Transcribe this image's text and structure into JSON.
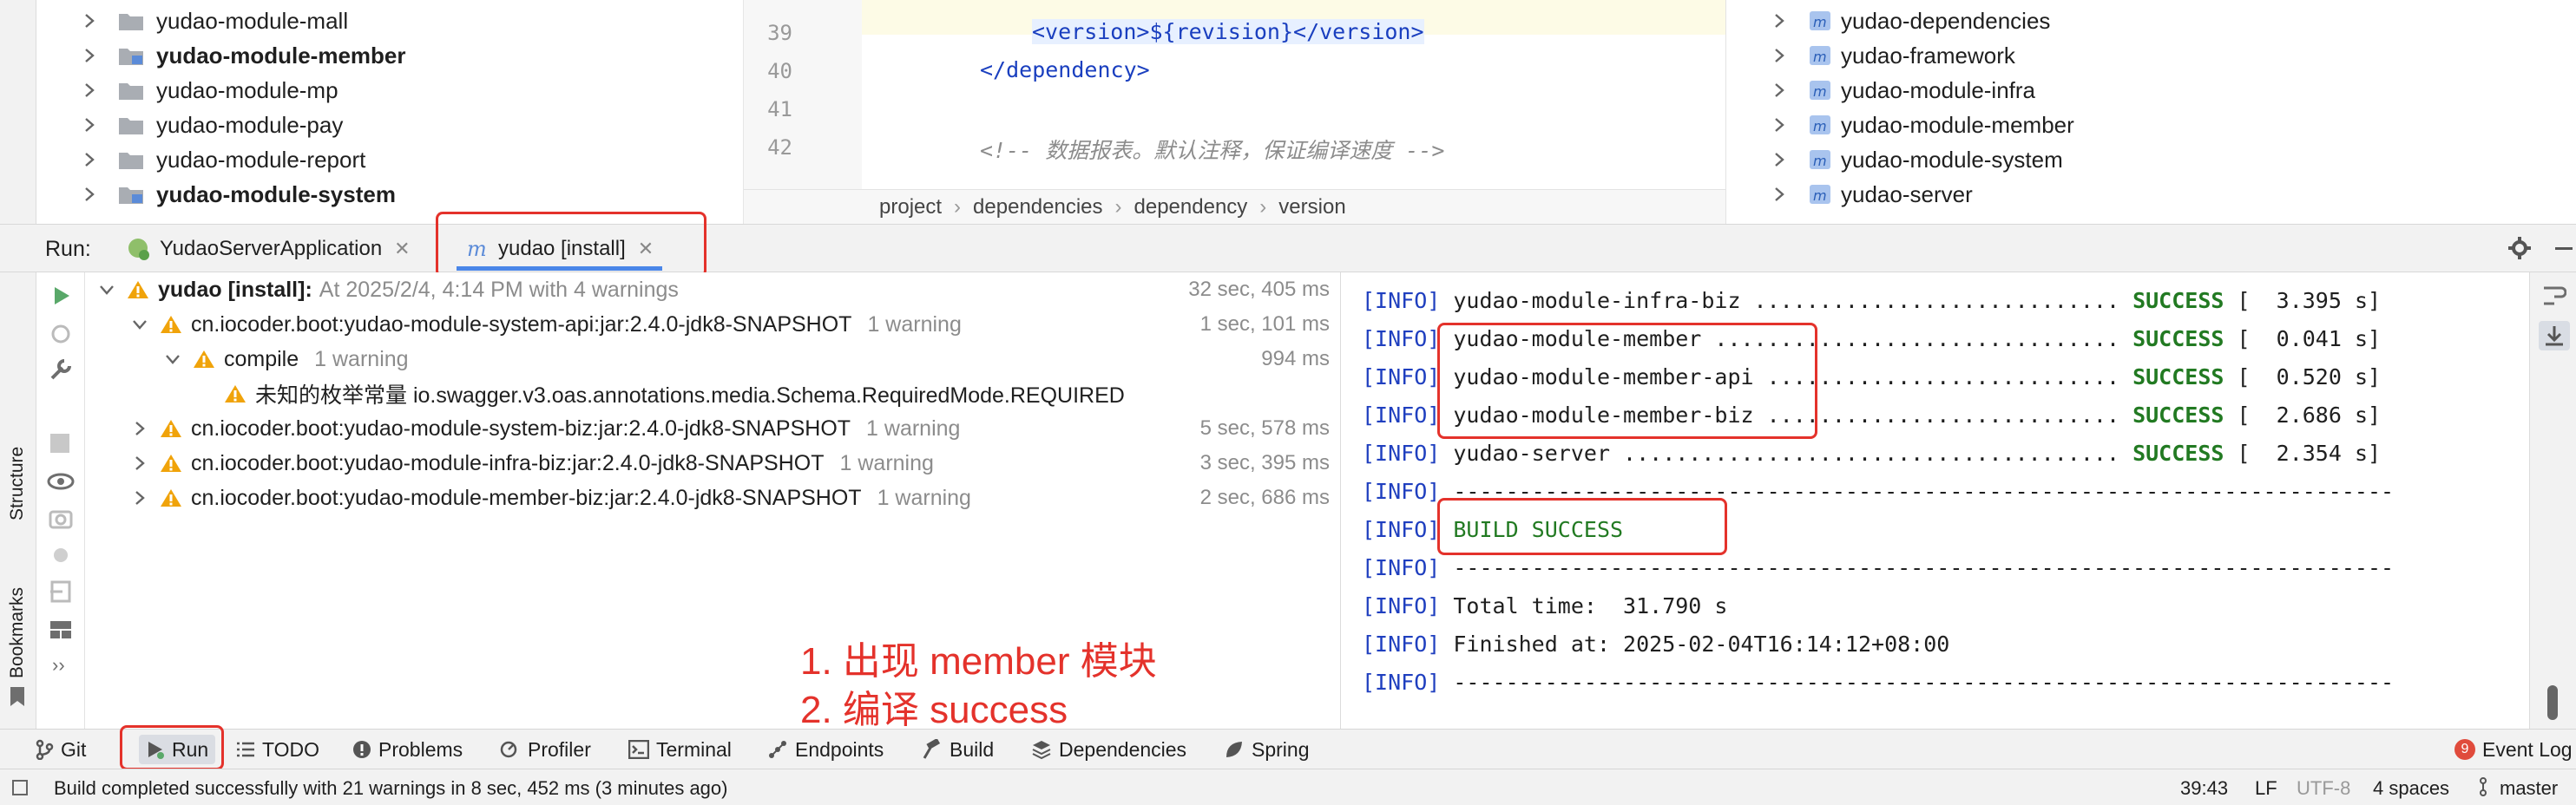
{
  "project_tree": {
    "items": [
      {
        "label": "yudao-module-mall",
        "bold": false
      },
      {
        "label": "yudao-module-member",
        "bold": true
      },
      {
        "label": "yudao-module-mp",
        "bold": false
      },
      {
        "label": "yudao-module-pay",
        "bold": false
      },
      {
        "label": "yudao-module-report",
        "bold": false
      },
      {
        "label": "yudao-module-system",
        "bold": true
      }
    ]
  },
  "editor": {
    "lines": [
      {
        "num": "39",
        "code": "<version>${revision}</version>"
      },
      {
        "num": "40",
        "code": "</dependency>"
      },
      {
        "num": "41",
        "code": ""
      },
      {
        "num": "42",
        "code": "<!-- 数据报表。默认注释，保证编译速度 -->"
      }
    ],
    "breadcrumb": [
      "project",
      "dependencies",
      "dependency",
      "version"
    ]
  },
  "maven": {
    "items": [
      "yudao-dependencies",
      "yudao-framework",
      "yudao-module-infra",
      "yudao-module-member",
      "yudao-module-system",
      "yudao-server"
    ]
  },
  "run": {
    "label": "Run:",
    "tabs": [
      {
        "label": "YudaoServerApplication",
        "active": false
      },
      {
        "label": "yudao [install]",
        "active": true
      }
    ]
  },
  "sidebar": {
    "structure_label": "Structure",
    "bookmarks_label": "Bookmarks"
  },
  "build_tree": {
    "root": {
      "label": "yudao [install]:",
      "detail": "At 2025/2/4, 4:14 PM with 4 warnings",
      "time": "32 sec, 405 ms"
    },
    "rows": [
      {
        "label": "cn.iocoder.boot:yudao-module-system-api:jar:2.4.0-jdk8-SNAPSHOT",
        "warn": "1 warning",
        "time": "1 sec, 101 ms"
      },
      {
        "label": "compile",
        "warn": "1 warning",
        "time": "994 ms"
      },
      {
        "label": "未知的枚举常量 io.swagger.v3.oas.annotations.media.Schema.RequiredMode.REQUIRED",
        "warn": "",
        "time": ""
      },
      {
        "label": "cn.iocoder.boot:yudao-module-system-biz:jar:2.4.0-jdk8-SNAPSHOT",
        "warn": "1 warning",
        "time": "5 sec, 578 ms"
      },
      {
        "label": "cn.iocoder.boot:yudao-module-infra-biz:jar:2.4.0-jdk8-SNAPSHOT",
        "warn": "1 warning",
        "time": "3 sec, 395 ms"
      },
      {
        "label": "cn.iocoder.boot:yudao-module-member-biz:jar:2.4.0-jdk8-SNAPSHOT",
        "warn": "1 warning",
        "time": "2 sec, 686 ms"
      }
    ]
  },
  "console": {
    "level": "[INFO]",
    "lines": [
      {
        "text": "yudao-module-infra-biz ............................",
        "status": "SUCCESS",
        "time": "[  3.395 s]"
      },
      {
        "text": "yudao-module-member ...............................",
        "status": "SUCCESS",
        "time": "[  0.041 s]"
      },
      {
        "text": "yudao-module-member-api ...........................",
        "status": "SUCCESS",
        "time": "[  0.520 s]"
      },
      {
        "text": "yudao-module-member-biz ...........................",
        "status": "SUCCESS",
        "time": "[  2.686 s]"
      },
      {
        "text": "yudao-server ......................................",
        "status": "SUCCESS",
        "time": "[  2.354 s]"
      },
      {
        "text": "------------------------------------------------------------------------",
        "status": "",
        "time": ""
      },
      {
        "text": "",
        "status": "BUILD SUCCESS",
        "time": ""
      },
      {
        "text": "------------------------------------------------------------------------",
        "status": "",
        "time": ""
      },
      {
        "text": "Total time:  31.790 s",
        "status": "",
        "time": ""
      },
      {
        "text": "Finished at: 2025-02-04T16:14:12+08:00",
        "status": "",
        "time": ""
      },
      {
        "text": "------------------------------------------------------------------------",
        "status": "",
        "time": ""
      }
    ]
  },
  "annotations": {
    "note_1": "1. 出现 member 模块",
    "note_2": "2. 编译 success"
  },
  "toolbar": {
    "items": [
      "Git",
      "Run",
      "TODO",
      "Problems",
      "Profiler",
      "Terminal",
      "Endpoints",
      "Build",
      "Dependencies",
      "Spring"
    ],
    "event_log": "Event Log",
    "event_count": "9"
  },
  "status_bar": {
    "message": "Build completed successfully with 21 warnings in 8 sec, 452 ms (3 minutes ago)",
    "position": "39:43",
    "line_sep": "LF",
    "encoding": "UTF-8",
    "indent": "4 spaces",
    "branch": "master"
  },
  "colors": {
    "accent": "#4a86e8",
    "annotation": "#e4322b",
    "success": "#227a22",
    "warning": "#f0a30a"
  }
}
